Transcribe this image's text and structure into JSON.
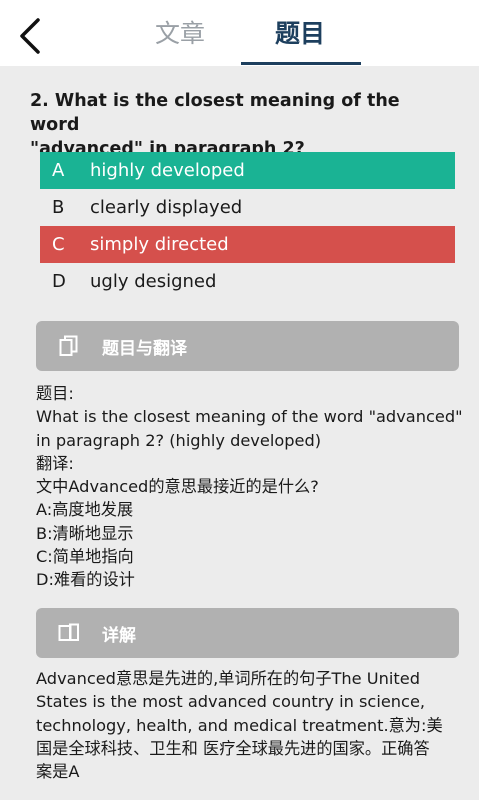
{
  "header": {
    "tabs": [
      {
        "label": "文章"
      },
      {
        "label": "题目"
      }
    ]
  },
  "question": {
    "line1": "2. What is the closest meaning of the word",
    "line2": "\"advanced\" in paragraph 2?"
  },
  "options": [
    {
      "letter": "A",
      "text": "highly developed",
      "state": "correct"
    },
    {
      "letter": "B",
      "text": "clearly displayed",
      "state": "normal"
    },
    {
      "letter": "C",
      "text": "simply directed",
      "state": "wrong"
    },
    {
      "letter": "D",
      "text": "ugly designed",
      "state": "normal"
    }
  ],
  "translation_section": {
    "title": "题目与翻译",
    "lines": [
      "题目:",
      "What is the closest meaning of the word \"advanced\"",
      "in paragraph 2? (highly developed)",
      "翻译:",
      "文中Advanced的意思最接近的是什么?",
      "A:高度地发展",
      "B:清晰地显示",
      "C:简单地指向",
      "D:难看的设计"
    ]
  },
  "explanation_section": {
    "title": "详解",
    "lines": [
      "Advanced意思是先进的,单词所在的句子The United",
      "States is the most advanced country in science,",
      "technology, health, and medical treatment.意为:美",
      "国是全球科技、卫生和 医疗全球最先进的国家。正确答",
      "案是A"
    ]
  },
  "colors": {
    "correct": "#1ab394",
    "wrong": "#d5504c",
    "active_tab": "#1d3f5e",
    "section_bar": "#b1b1b1"
  },
  "icons": {
    "back": "chevron-left-icon",
    "translation": "copy-document-icon",
    "explanation": "tablet-phone-icon"
  }
}
